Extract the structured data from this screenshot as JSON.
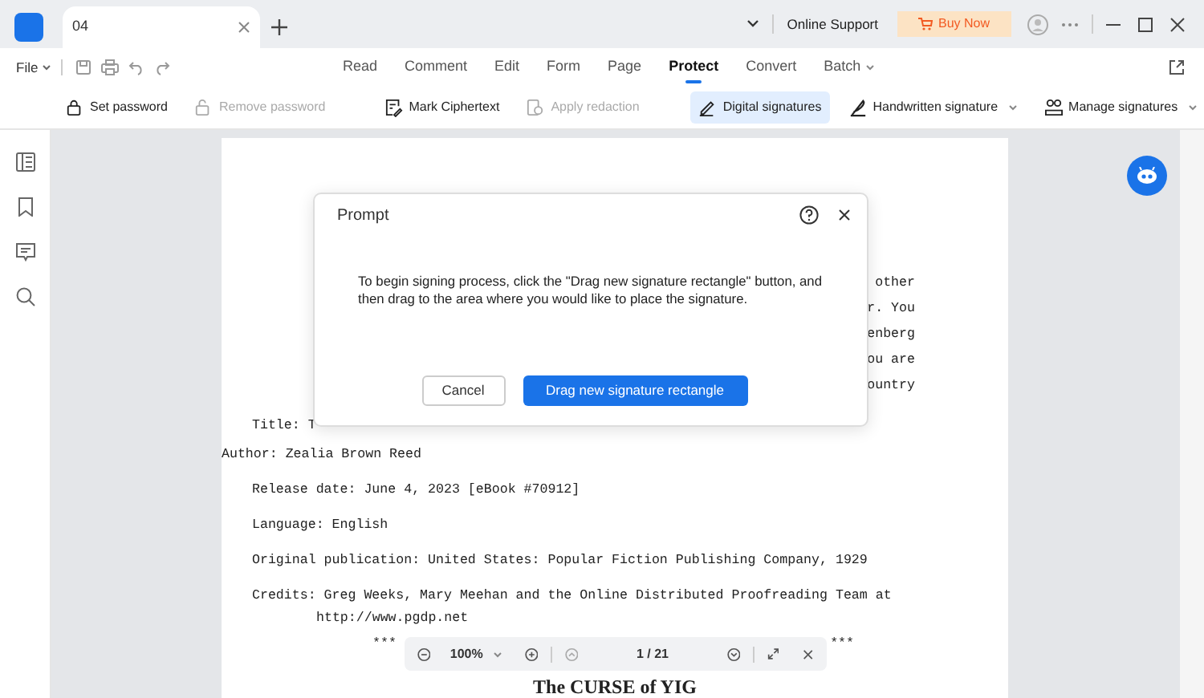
{
  "tab": {
    "title": "04"
  },
  "title_bar": {
    "support": "Online Support",
    "buy": "Buy Now"
  },
  "menu": {
    "file": "File",
    "tabs": [
      {
        "label": "Read",
        "selected": false,
        "has_menu": false
      },
      {
        "label": "Comment",
        "selected": false,
        "has_menu": false
      },
      {
        "label": "Edit",
        "selected": false,
        "has_menu": false
      },
      {
        "label": "Form",
        "selected": false,
        "has_menu": false
      },
      {
        "label": "Page",
        "selected": false,
        "has_menu": false
      },
      {
        "label": "Protect",
        "selected": true,
        "has_menu": false
      },
      {
        "label": "Convert",
        "selected": false,
        "has_menu": false
      },
      {
        "label": "Batch",
        "selected": false,
        "has_menu": true
      }
    ]
  },
  "ribbon": [
    {
      "kind": "lock",
      "label": "Set password",
      "disabled": false,
      "selected": false,
      "has_menu": false
    },
    {
      "kind": "unlock",
      "label": "Remove password",
      "disabled": true,
      "selected": false,
      "has_menu": false
    },
    {
      "kind": "divider"
    },
    {
      "kind": "cipher",
      "label": "Mark Ciphertext",
      "disabled": false,
      "selected": false,
      "has_menu": false
    },
    {
      "kind": "redact",
      "label": "Apply redaction",
      "disabled": true,
      "selected": false,
      "has_menu": false
    },
    {
      "kind": "divider"
    },
    {
      "kind": "pen",
      "label": "Digital signatures",
      "disabled": false,
      "selected": true,
      "has_menu": false
    },
    {
      "kind": "quill",
      "label": "Handwritten signature",
      "disabled": false,
      "selected": false,
      "has_menu": true
    },
    {
      "kind": "people",
      "label": "Manage signatures",
      "disabled": false,
      "selected": false,
      "has_menu": true
    }
  ],
  "document": {
    "fragments": [
      "other",
      "r. You",
      "enberg",
      "ou are",
      "ountry"
    ],
    "lines": [
      {
        "kind": "para",
        "text": "Title: T"
      },
      {
        "kind": "flush",
        "text": "Author: Zealia Brown Reed"
      },
      {
        "kind": "para",
        "text": "Release date: June 4, 2023 [eBook #70912]"
      },
      {
        "kind": "para",
        "text": "Language: English"
      },
      {
        "kind": "para",
        "text": "Original publication: United States: Popular Fiction Publishing Company, 1929"
      },
      {
        "kind": "para",
        "text": "Credits: Greg Weeks, Mary Meehan and the Online Distributed Proofreading Team at"
      },
      {
        "kind": "wrap",
        "text": "http://www.pgdp.net"
      }
    ],
    "separators": [
      "***",
      "***"
    ],
    "heading": "The CURSE of YIG"
  },
  "dialog": {
    "title": "Prompt",
    "message": "To begin signing process, click the \"Drag new signature rectangle\" button, and then drag to the area where you would like to place the signature.",
    "cancel": "Cancel",
    "confirm": "Drag new signature rectangle"
  },
  "page_toolbar": {
    "zoom": "100%",
    "page": "1 / 21"
  }
}
